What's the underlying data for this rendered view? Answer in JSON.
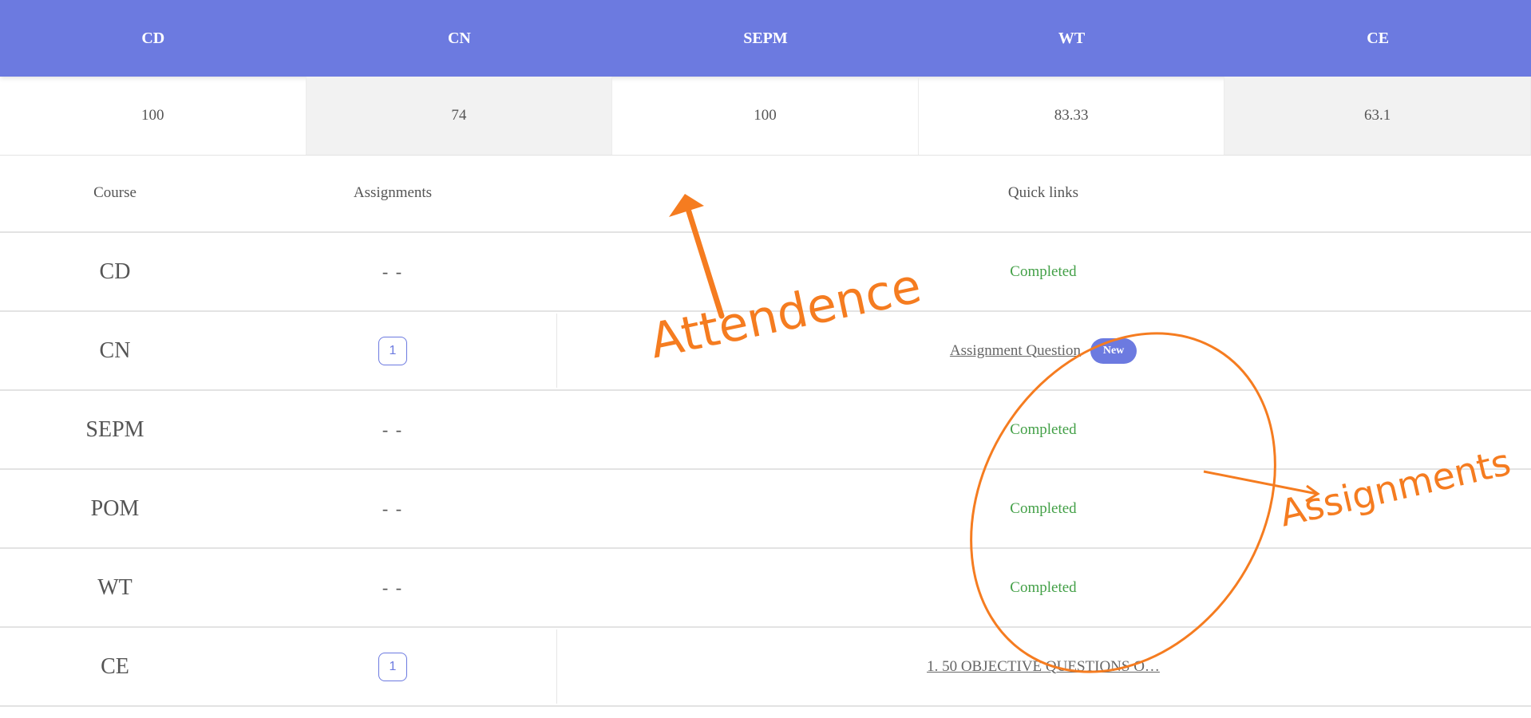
{
  "attendance": {
    "headers": [
      "CD",
      "CN",
      "SEPM",
      "WT",
      "CE"
    ],
    "values": [
      "100",
      "74",
      "100",
      "83.33",
      "63.1"
    ]
  },
  "course_table": {
    "headers": {
      "course": "Course",
      "assignments": "Assignments",
      "quick_links": "Quick links"
    },
    "rows": [
      {
        "course": "CD",
        "assignments": "- -",
        "status": "Completed"
      },
      {
        "course": "CN",
        "assignments_count": "1",
        "link": "Assignment Question",
        "badge": "New"
      },
      {
        "course": "SEPM",
        "assignments": "- -",
        "status": "Completed"
      },
      {
        "course": "POM",
        "assignments": "- -",
        "status": "Completed"
      },
      {
        "course": "WT",
        "assignments": "- -",
        "status": "Completed"
      },
      {
        "course": "CE",
        "assignments_count": "1",
        "link": "1. 50 OBJECTIVE QUESTIONS O…"
      }
    ]
  },
  "annotations": {
    "attendance_label": "Attendence",
    "assignments_label": "Assignments",
    "color": "#f57c20"
  },
  "colors": {
    "header_bg": "#6c7ae0",
    "completed": "#43a047",
    "accent": "#6c7ae0"
  }
}
